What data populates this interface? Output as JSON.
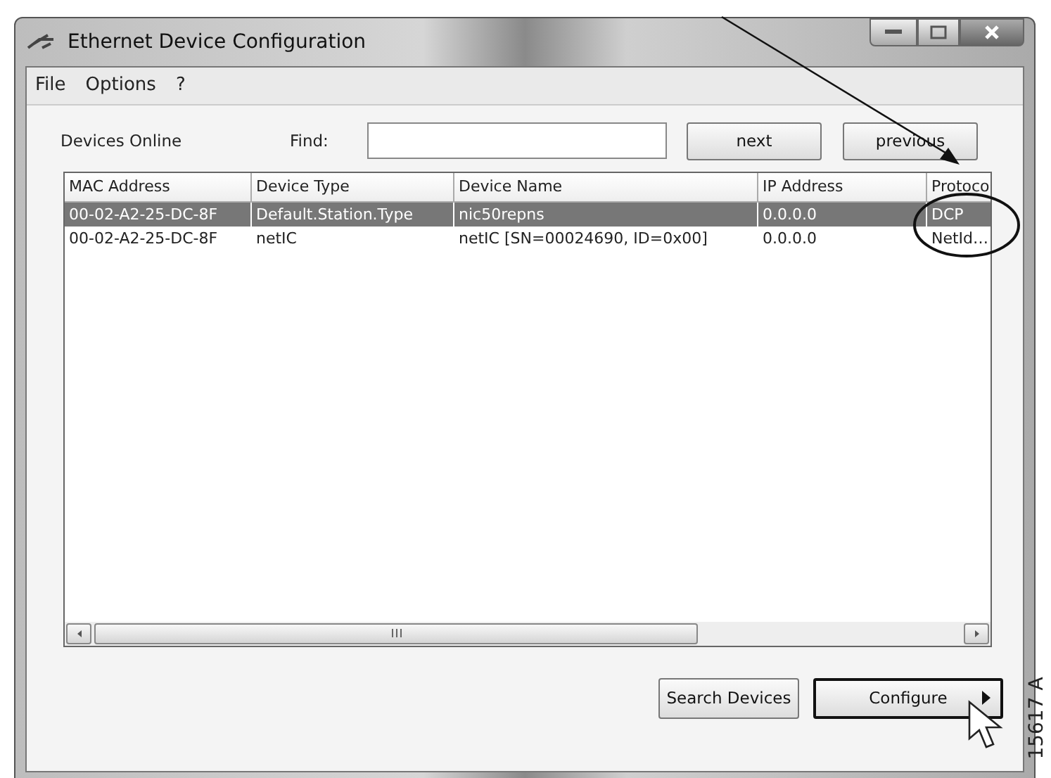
{
  "window": {
    "title": "Ethernet Device Configuration"
  },
  "menu": [
    "File",
    "Options",
    "?"
  ],
  "toolbar": {
    "label": "Devices Online",
    "find_label": "Find:",
    "buttons": [
      "next",
      "previous"
    ]
  },
  "table": {
    "columns": [
      "MAC Address",
      "Device Type",
      "Device Name",
      "IP Address",
      "Protoco"
    ],
    "rows": [
      {
        "cells": [
          "00-02-A2-25-DC-8F",
          "Default.Station.Type",
          "nic50repns",
          "0.0.0.0",
          "DCP"
        ],
        "selected": true
      },
      {
        "cells": [
          "00-02-A2-25-DC-8F",
          "netIC",
          "netIC [SN=00024690, ID=0x00]",
          "0.0.0.0",
          "NetId…"
        ],
        "selected": false
      }
    ]
  },
  "buttons": [
    {
      "label": "Search Devices",
      "kind": "normal"
    },
    {
      "label": "Configure",
      "kind": "split"
    }
  ],
  "figure_label": "15617 A"
}
